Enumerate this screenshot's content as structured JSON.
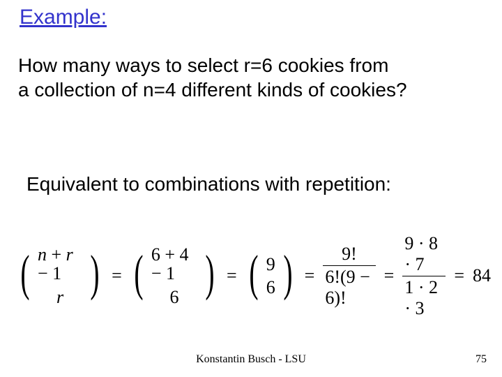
{
  "title": "Example:",
  "body": {
    "line1_pre": "How many ways to select ",
    "line1_rvar": "r=6",
    "line1_post": " cookies from",
    "line2_pre": "a collection of ",
    "line2_nvar": "n=4",
    "line2_post": " different kinds of cookies?"
  },
  "equiv": "Equivalent to combinations with repetition:",
  "formula": {
    "binom1_top_a": "n",
    "binom1_top_b": "r",
    "binom1_top_c": "1",
    "binom1_bot": "r",
    "binom2_top": "6 + 4 − 1",
    "binom2_bot": "6",
    "binom3_top": "9",
    "binom3_bot": "6",
    "frac1_num": "9!",
    "frac1_den": "6!(9 − 6)!",
    "frac2_num": "9 · 8 · 7",
    "frac2_den": "1 · 2 · 3",
    "result": "84"
  },
  "footer": {
    "author": "Konstantin Busch - LSU",
    "page": "75"
  }
}
